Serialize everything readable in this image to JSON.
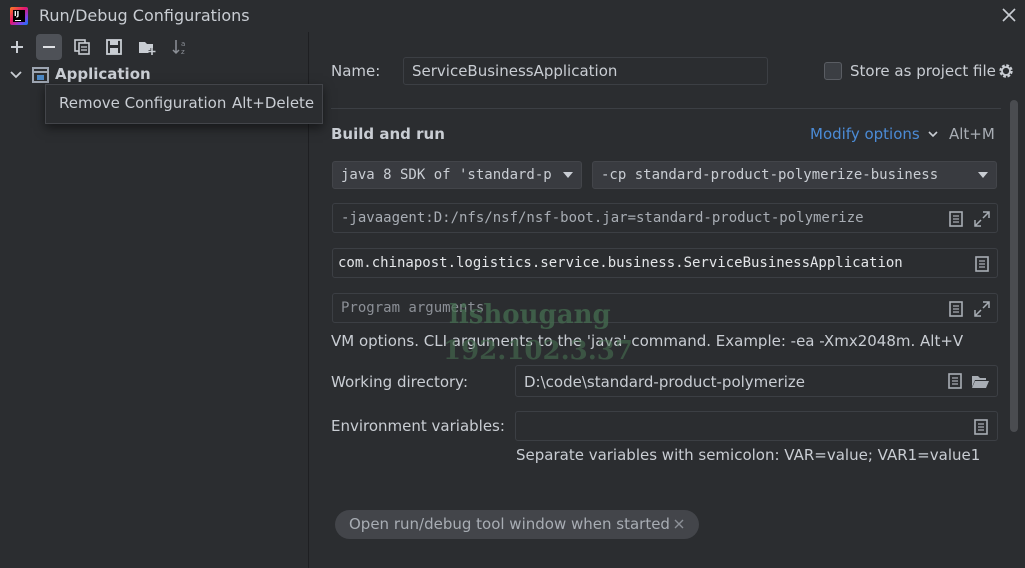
{
  "window": {
    "title": "Run/Debug Configurations"
  },
  "toolbar": {
    "buttons": [
      {
        "name": "add-button",
        "icon": "plus-icon"
      },
      {
        "name": "remove-button",
        "icon": "minus-icon",
        "active": true
      },
      {
        "name": "copy-button",
        "icon": "copy-icon"
      },
      {
        "name": "save-button",
        "icon": "save-icon"
      },
      {
        "name": "new-folder-button",
        "icon": "folder-add-icon"
      },
      {
        "name": "sort-button",
        "icon": "sort-alpha-icon"
      }
    ]
  },
  "tree": {
    "items": [
      {
        "label": "Application",
        "expanded": true,
        "icon": "application-icon"
      }
    ]
  },
  "tooltip": {
    "text": "Remove Configuration",
    "shortcut": "Alt+Delete"
  },
  "form": {
    "name_label": "Name:",
    "name_value": "ServiceBusinessApplication",
    "store_label": "Store as project file",
    "store_checked": false,
    "section_title": "Build and run",
    "modify_options": "Modify options",
    "modify_shortcut": "Alt+M",
    "jdk_value": "java 8 SDK of 'standard-pro",
    "classpath_value": "-cp standard-product-polymerize-business",
    "vm_options_value": "-javaagent:D:/nfs/nsf/nsf-boot.jar=standard-product-polymerize",
    "main_class_value": "com.chinapost.logistics.service.business.ServiceBusinessApplication",
    "program_args_placeholder": "Program arguments",
    "vm_hint": "VM options. CLI arguments to the 'java' command. Example: -ea -Xmx2048m. Alt+V",
    "workdir_label": "Working directory:",
    "workdir_value": "D:\\code\\standard-product-polymerize",
    "env_label": "Environment variables:",
    "env_value": "",
    "env_hint": "Separate variables with semicolon: VAR=value; VAR1=value1",
    "chip_label": "Open run/debug tool window when started"
  },
  "watermark": {
    "user": "lishougang",
    "ip": "192.102.3.37"
  },
  "colors": {
    "background": "#2b2d30",
    "accent_link": "#4b8bd6",
    "text": "#c9cdd3"
  }
}
